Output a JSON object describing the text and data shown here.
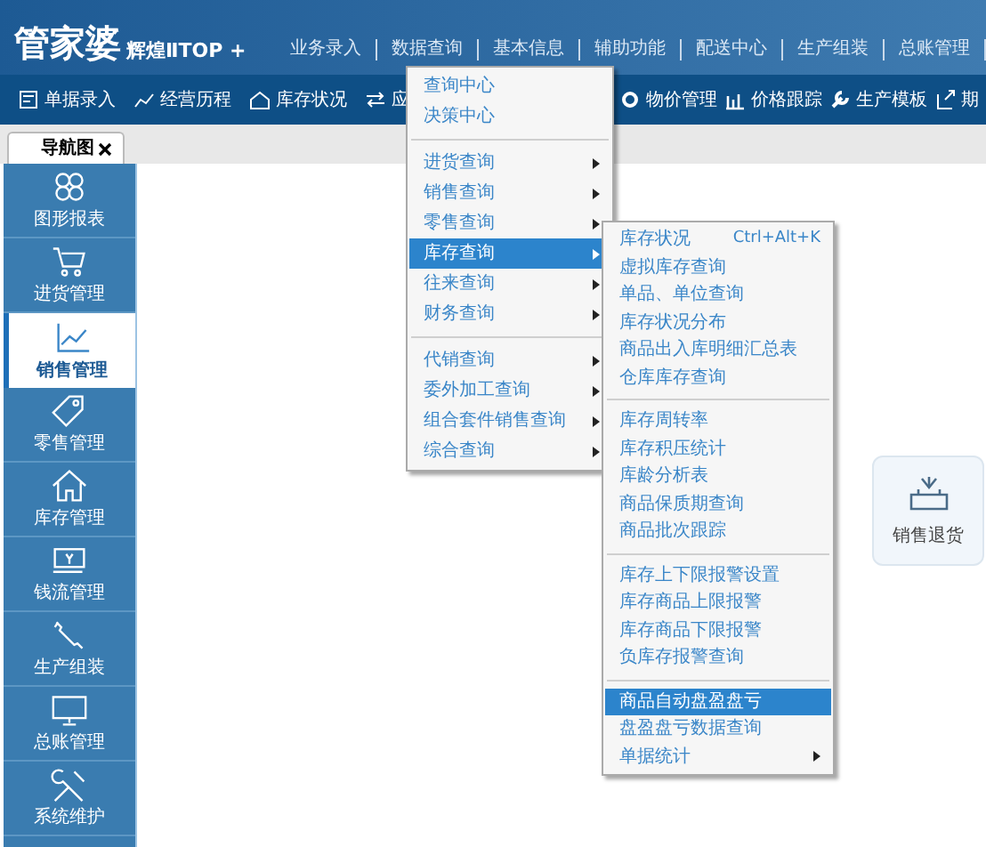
{
  "logo": {
    "brand": "管家婆",
    "edition": "辉煌ⅡTOP +"
  },
  "menu_bar": [
    "业务录入",
    "数据查询",
    "基本信息",
    "辅助功能",
    "配送中心",
    "生产组装",
    "总账管理"
  ],
  "toolbar": [
    "单据录入",
    "经营历程",
    "库存状况",
    "应",
    "物价管理",
    "价格跟踪",
    "生产模板",
    "期"
  ],
  "nav_tab": {
    "label": "导航图"
  },
  "sidebar": {
    "items": [
      {
        "label": "图形报表",
        "selected": false
      },
      {
        "label": "进货管理",
        "selected": false
      },
      {
        "label": "销售管理",
        "selected": true
      },
      {
        "label": "零售管理",
        "selected": false
      },
      {
        "label": "库存管理",
        "selected": false
      },
      {
        "label": "钱流管理",
        "selected": false
      },
      {
        "label": "生产组装",
        "selected": false
      },
      {
        "label": "总账管理",
        "selected": false
      },
      {
        "label": "系统维护",
        "selected": false
      }
    ]
  },
  "shortcut_card": {
    "label": "销售退货"
  },
  "dropdown": {
    "items": [
      {
        "kind": "item",
        "label": "查询中心",
        "submenu": false,
        "selected": false
      },
      {
        "kind": "item",
        "label": "决策中心",
        "submenu": false,
        "selected": false
      },
      {
        "kind": "separator"
      },
      {
        "kind": "item",
        "label": "进货查询",
        "submenu": true,
        "selected": false
      },
      {
        "kind": "item",
        "label": "销售查询",
        "submenu": true,
        "selected": false
      },
      {
        "kind": "item",
        "label": "零售查询",
        "submenu": true,
        "selected": false
      },
      {
        "kind": "item",
        "label": "库存查询",
        "submenu": true,
        "selected": true
      },
      {
        "kind": "item",
        "label": "往来查询",
        "submenu": true,
        "selected": false
      },
      {
        "kind": "item",
        "label": "财务查询",
        "submenu": true,
        "selected": false
      },
      {
        "kind": "separator"
      },
      {
        "kind": "item",
        "label": "代销查询",
        "submenu": true,
        "selected": false
      },
      {
        "kind": "item",
        "label": "委外加工查询",
        "submenu": true,
        "selected": false
      },
      {
        "kind": "item",
        "label": "组合套件销售查询",
        "submenu": true,
        "selected": false
      },
      {
        "kind": "item",
        "label": "综合查询",
        "submenu": true,
        "selected": false
      }
    ]
  },
  "submenu": {
    "items": [
      {
        "kind": "item",
        "label": "库存状况",
        "shortcut": "Ctrl+Alt+K",
        "submenu": false,
        "selected": false
      },
      {
        "kind": "item",
        "label": "虚拟库存查询",
        "submenu": false,
        "selected": false
      },
      {
        "kind": "item",
        "label": "单品、单位查询",
        "submenu": false,
        "selected": false
      },
      {
        "kind": "item",
        "label": "库存状况分布",
        "submenu": false,
        "selected": false
      },
      {
        "kind": "item",
        "label": "商品出入库明细汇总表",
        "submenu": false,
        "selected": false
      },
      {
        "kind": "item",
        "label": "仓库库存查询",
        "submenu": false,
        "selected": false
      },
      {
        "kind": "separator"
      },
      {
        "kind": "item",
        "label": "库存周转率",
        "submenu": false,
        "selected": false
      },
      {
        "kind": "item",
        "label": "库存积压统计",
        "submenu": false,
        "selected": false
      },
      {
        "kind": "item",
        "label": "库龄分析表",
        "submenu": false,
        "selected": false
      },
      {
        "kind": "item",
        "label": "商品保质期查询",
        "submenu": false,
        "selected": false
      },
      {
        "kind": "item",
        "label": "商品批次跟踪",
        "submenu": false,
        "selected": false
      },
      {
        "kind": "separator"
      },
      {
        "kind": "item",
        "label": "库存上下限报警设置",
        "submenu": false,
        "selected": false
      },
      {
        "kind": "item",
        "label": "库存商品上限报警",
        "submenu": false,
        "selected": false
      },
      {
        "kind": "item",
        "label": "库存商品下限报警",
        "submenu": false,
        "selected": false
      },
      {
        "kind": "item",
        "label": "负库存报警查询",
        "submenu": false,
        "selected": false
      },
      {
        "kind": "separator"
      },
      {
        "kind": "item",
        "label": "商品自动盘盈盘亏",
        "submenu": false,
        "selected": true
      },
      {
        "kind": "item",
        "label": "盘盈盘亏数据查询",
        "submenu": false,
        "selected": false
      },
      {
        "kind": "item",
        "label": "单据统计",
        "submenu": true,
        "selected": false
      }
    ]
  }
}
